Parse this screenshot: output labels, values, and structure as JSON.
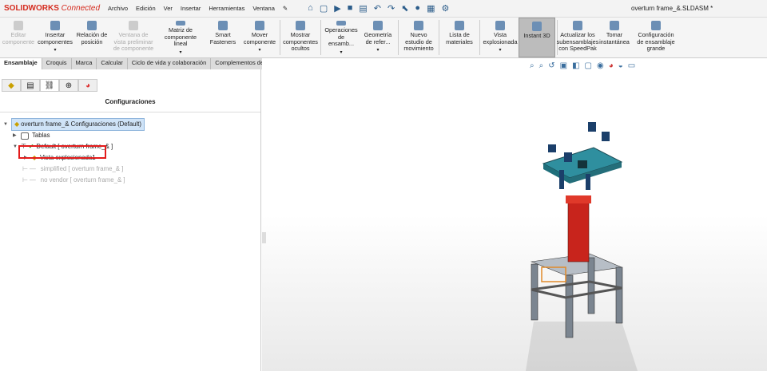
{
  "app": {
    "brand": "SOLIDWORKS",
    "brand_suffix": "Connected",
    "document_title": "overturn frame_&.SLDASM *"
  },
  "menu": [
    "Archivo",
    "Edición",
    "Ver",
    "Insertar",
    "Herramientas",
    "Ventana"
  ],
  "quick_access_icons": [
    "home-icon",
    "new-icon",
    "open-icon",
    "save-icon",
    "print-icon",
    "undo-icon",
    "redo-icon",
    "select-icon",
    "traffic-light-icon",
    "file-properties-icon",
    "options-icon"
  ],
  "ribbon": [
    {
      "label": "Editar componente",
      "disabled": true
    },
    {
      "label": "Insertar componentes",
      "dropdown": true
    },
    {
      "label": "Relación de posición"
    },
    {
      "label": "Ventana de vista preliminar de componente",
      "disabled": true
    },
    {
      "label": "Matriz de componente lineal",
      "dropdown": true
    },
    {
      "label": "Smart Fasteners"
    },
    {
      "label": "Mover componente",
      "dropdown": true
    },
    {
      "label": "Mostrar componentes ocultos"
    },
    {
      "label": "Operaciones de ensamb...",
      "dropdown": true
    },
    {
      "label": "Geometría de refer...",
      "dropdown": true
    },
    {
      "label": "Nuevo estudio de movimiento"
    },
    {
      "label": "Lista de materiales"
    },
    {
      "label": "Vista explosionada",
      "dropdown": true
    },
    {
      "label": "Instant 3D",
      "active": true
    },
    {
      "label": "Actualizar los subensamblajes con SpeedPak"
    },
    {
      "label": "Tomar instantánea"
    },
    {
      "label": "Configuración de ensamblaje grande"
    }
  ],
  "tabs": [
    "Ensamblaje",
    "Croquis",
    "Marca",
    "Calcular",
    "Ciclo de vida y colaboración",
    "Complementos de SOLIDWORKS"
  ],
  "active_tab": "Ensamblaje",
  "panel": {
    "title": "Configuraciones",
    "tree": [
      {
        "label": "overturn frame_& Configuraciones  (Default)"
      },
      {
        "label": "Tablas"
      },
      {
        "label": "Default [ overturn frame_& ]"
      },
      {
        "label": "Vista explosionada1"
      },
      {
        "label": "simplified [ overturn frame_& ]"
      },
      {
        "label": "no vendor [ overturn frame_& ]"
      }
    ]
  },
  "colors": {
    "brand": "#d52b1e",
    "highlight": "#e31b1b",
    "plate": "#2f8f9f",
    "column": "#c8241c"
  }
}
